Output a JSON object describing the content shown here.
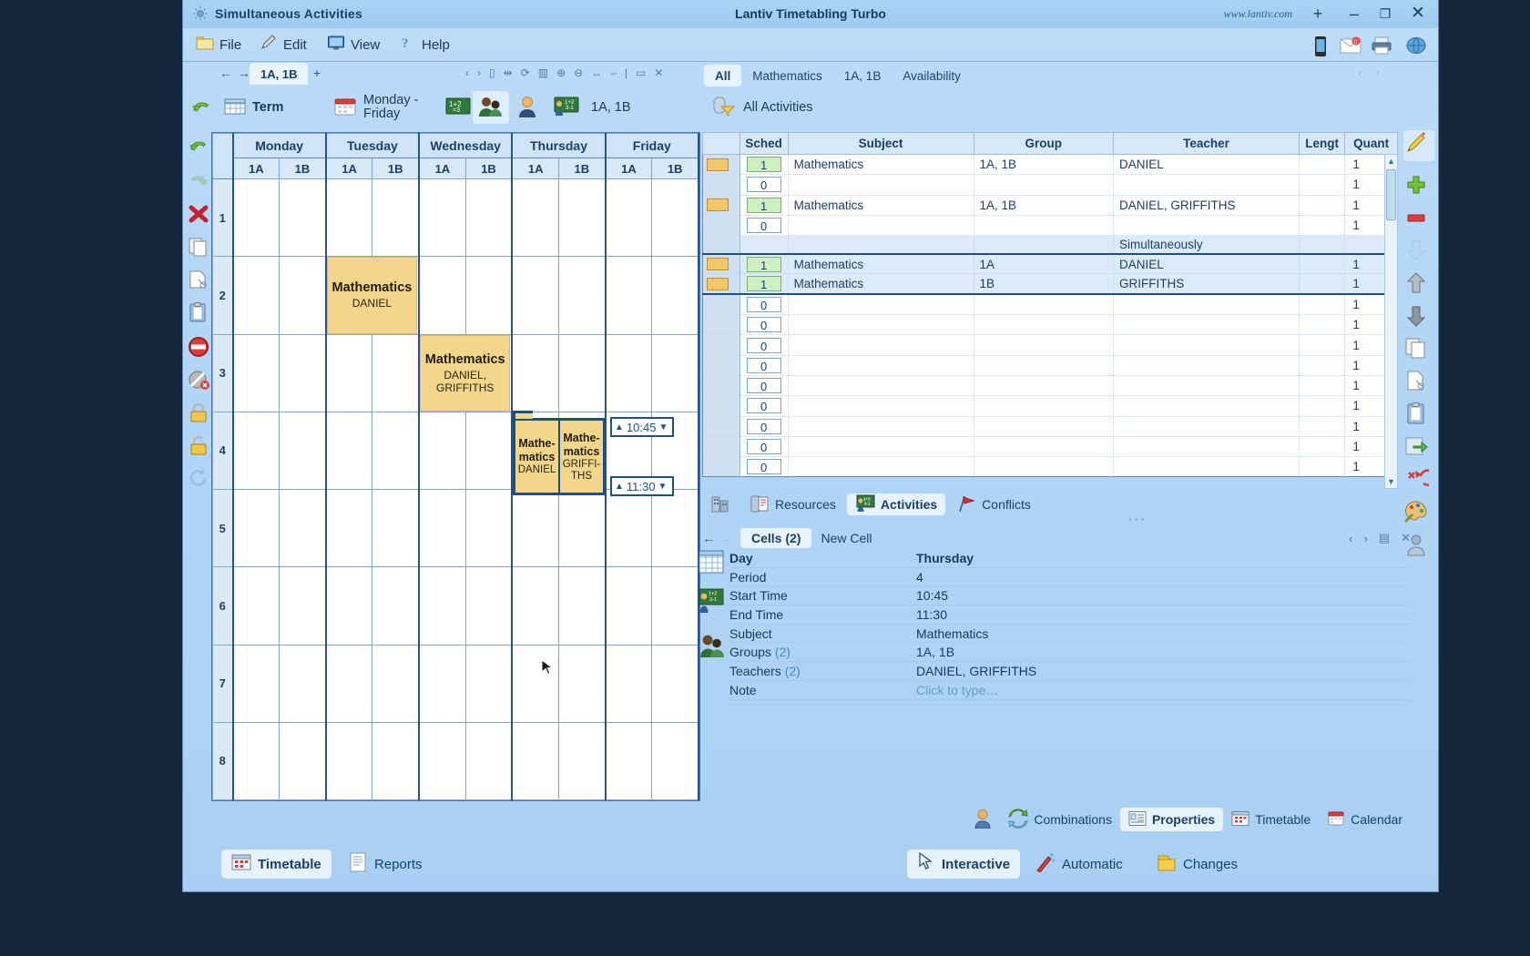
{
  "window": {
    "doc_title": "Simultaneous Activities",
    "app_title": "Lantiv Timetabling Turbo",
    "website": "www.lantiv.com",
    "btn_add": "+",
    "btn_minimize": "–",
    "btn_maximize": "❐",
    "btn_close": "✕"
  },
  "menu": [
    {
      "label": "File",
      "icon": "folder-icon"
    },
    {
      "label": "Edit",
      "icon": "pencil-icon"
    },
    {
      "label": "View",
      "icon": "monitor-icon"
    },
    {
      "label": "Help",
      "icon": "question-icon"
    }
  ],
  "tabstrip": {
    "back": "←",
    "forward": "→",
    "current_tab": "1A, 1B",
    "add_tab": "+",
    "right_tabs": [
      {
        "label": "All",
        "active": true
      },
      {
        "label": "Mathematics",
        "active": false
      },
      {
        "label": "1A, 1B",
        "active": false
      },
      {
        "label": "Availability",
        "active": false
      }
    ]
  },
  "toolbar": {
    "undo_icon": "undo-icon",
    "redo_icon": "redo-icon",
    "term_label": "Term",
    "days_label_line1": "Monday -",
    "days_label_line2": "Friday",
    "subject_icon": "blackboard-icon",
    "groups_icon": "groups-icon",
    "teacher_icon": "teacher-icon",
    "activity_icon": "activity-icon",
    "groups_label": "1A, 1B",
    "filter_label": "All Activities"
  },
  "timetable": {
    "days": [
      "Monday",
      "Tuesday",
      "Wednesday",
      "Thursday",
      "Friday"
    ],
    "groups": [
      "1A",
      "1B"
    ],
    "periods": [
      "1",
      "2",
      "3",
      "4",
      "5",
      "6",
      "7",
      "8"
    ],
    "activities": [
      {
        "day": "Tuesday",
        "period": 2,
        "group": "1A",
        "span": 2,
        "subject": "Mathematics",
        "teachers": "DANIEL"
      },
      {
        "day": "Wednesday",
        "period": 3,
        "group": "1A",
        "span": 2,
        "subject": "Mathematics",
        "teachers": "DANIEL, GRIFFITHS"
      },
      {
        "day": "Thursday",
        "period": 4,
        "group": "1A",
        "span": 1,
        "subject": "Mathe-matics",
        "teachers": "DANIEL"
      },
      {
        "day": "Thursday",
        "period": 4,
        "group": "1B",
        "span": 1,
        "subject": "Mathe-matics",
        "teachers": "GRIFFI-THS"
      }
    ],
    "start_time": "10:45",
    "end_time": "11:30"
  },
  "activities_table": {
    "columns": [
      "",
      "Sched",
      "Subject",
      "Group",
      "Teacher",
      "Lengt",
      "Quant"
    ],
    "simultaneously_label": "Simultaneously",
    "rows": [
      {
        "mark": true,
        "sched": "1",
        "subject": "Mathematics",
        "group": "1A, 1B",
        "teacher": "DANIEL",
        "length": "",
        "quantity": "1",
        "sim": false
      },
      {
        "mark": false,
        "sched": "0",
        "subject": "",
        "group": "",
        "teacher": "",
        "length": "",
        "quantity": "1",
        "sim": false
      },
      {
        "mark": true,
        "sched": "1",
        "subject": "Mathematics",
        "group": "1A, 1B",
        "teacher": "DANIEL, GRIFFITHS",
        "length": "",
        "quantity": "1",
        "sim": false
      },
      {
        "mark": false,
        "sched": "0",
        "subject": "",
        "group": "",
        "teacher": "",
        "length": "",
        "quantity": "1",
        "sim": false
      },
      {
        "mark": true,
        "sched": "1",
        "subject": "Mathematics",
        "group": "1A",
        "teacher": "DANIEL",
        "length": "",
        "quantity": "1",
        "sim": true
      },
      {
        "mark": true,
        "sched": "1",
        "subject": "Mathematics",
        "group": "1B",
        "teacher": "GRIFFITHS",
        "length": "",
        "quantity": "1",
        "sim": true
      },
      {
        "mark": false,
        "sched": "0",
        "subject": "",
        "group": "",
        "teacher": "",
        "length": "",
        "quantity": "1",
        "sim": false
      },
      {
        "mark": false,
        "sched": "0",
        "subject": "",
        "group": "",
        "teacher": "",
        "length": "",
        "quantity": "1",
        "sim": false
      },
      {
        "mark": false,
        "sched": "0",
        "subject": "",
        "group": "",
        "teacher": "",
        "length": "",
        "quantity": "1",
        "sim": false
      },
      {
        "mark": false,
        "sched": "0",
        "subject": "",
        "group": "",
        "teacher": "",
        "length": "",
        "quantity": "1",
        "sim": false
      },
      {
        "mark": false,
        "sched": "0",
        "subject": "",
        "group": "",
        "teacher": "",
        "length": "",
        "quantity": "1",
        "sim": false
      },
      {
        "mark": false,
        "sched": "0",
        "subject": "",
        "group": "",
        "teacher": "",
        "length": "",
        "quantity": "1",
        "sim": false
      },
      {
        "mark": false,
        "sched": "0",
        "subject": "",
        "group": "",
        "teacher": "",
        "length": "",
        "quantity": "1",
        "sim": false
      },
      {
        "mark": false,
        "sched": "0",
        "subject": "",
        "group": "",
        "teacher": "",
        "length": "",
        "quantity": "1",
        "sim": false
      },
      {
        "mark": false,
        "sched": "0",
        "subject": "",
        "group": "",
        "teacher": "",
        "length": "",
        "quantity": "1",
        "sim": false
      }
    ]
  },
  "panel_tabs": [
    {
      "label": "",
      "icon": "building-icon",
      "active": false
    },
    {
      "label": "Resources",
      "icon": "resources-icon",
      "active": false
    },
    {
      "label": "Activities",
      "icon": "activities-icon",
      "active": true
    },
    {
      "label": "Conflicts",
      "icon": "flag-icon",
      "active": false
    }
  ],
  "cells_bar": {
    "back": "←",
    "forward": "→",
    "title": "Cells (2)",
    "new_cell": "New Cell",
    "close": "✕"
  },
  "properties": [
    {
      "key": "Day",
      "count": "",
      "value": "Thursday",
      "bold": true,
      "placeholder": false
    },
    {
      "key": "Period",
      "count": "",
      "value": "4",
      "bold": false,
      "placeholder": false
    },
    {
      "key": "Start Time",
      "count": "",
      "value": "10:45",
      "bold": false,
      "placeholder": false
    },
    {
      "key": "End Time",
      "count": "",
      "value": "11:30",
      "bold": false,
      "placeholder": false
    },
    {
      "key": "Subject",
      "count": "",
      "value": "Mathematics",
      "bold": false,
      "placeholder": false
    },
    {
      "key": "Groups",
      "count": "(2)",
      "value": "1A, 1B",
      "bold": false,
      "placeholder": false
    },
    {
      "key": "Teachers",
      "count": "(2)",
      "value": "DANIEL, GRIFFITHS",
      "bold": false,
      "placeholder": false
    },
    {
      "key": "Note",
      "count": "",
      "value": "Click to type…",
      "bold": false,
      "placeholder": true
    }
  ],
  "combinations_bar": [
    {
      "label": "",
      "icon": "person-icon",
      "active": false
    },
    {
      "label": "Combinations",
      "icon": "refresh-icon",
      "active": false
    },
    {
      "label": "Properties",
      "icon": "properties-icon",
      "active": true
    },
    {
      "label": "Timetable",
      "icon": "timetable-icon",
      "active": false
    },
    {
      "label": "Calendar",
      "icon": "calendar-icon",
      "active": false
    }
  ],
  "statusbar": {
    "left": [
      {
        "label": "Timetable",
        "icon": "timetable-icon",
        "active": true
      },
      {
        "label": "Reports",
        "icon": "reports-icon",
        "active": false
      }
    ],
    "right": [
      {
        "label": "Interactive",
        "icon": "cursor-icon",
        "active": true
      },
      {
        "label": "Automatic",
        "icon": "magic-icon",
        "active": false
      },
      {
        "label": "Changes",
        "icon": "changes-icon",
        "active": false
      }
    ]
  },
  "colors": {
    "activity_fill": "#f3d68a",
    "selection_border": "#1d4f8c",
    "sched_on": "#cdf0c3",
    "mark_swatch": "#f3c768",
    "window_bg": "#b2d6f6"
  }
}
